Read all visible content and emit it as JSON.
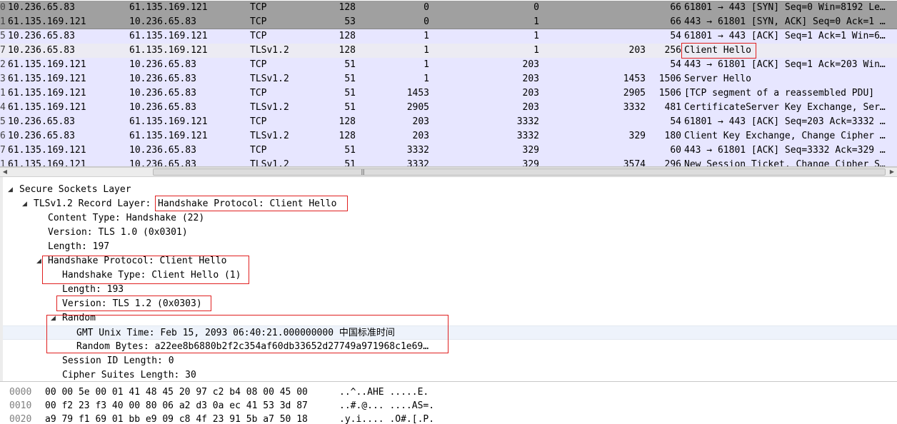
{
  "packets": [
    {
      "no": "0",
      "src": "10.236.65.83",
      "dst": "61.135.169.121",
      "proto": "TCP",
      "ttl": "128",
      "seq": "0",
      "ack": "0",
      "tcplen": "",
      "len": "66",
      "info": "61801 → 443 [SYN] Seq=0 Win=8192 Le…",
      "bg": "#a0a0a0"
    },
    {
      "no": "1",
      "src": "61.135.169.121",
      "dst": "10.236.65.83",
      "proto": "TCP",
      "ttl": "53",
      "seq": "0",
      "ack": "1",
      "tcplen": "",
      "len": "66",
      "info": "443 → 61801 [SYN, ACK] Seq=0 Ack=1 …",
      "bg": "#a0a0a0"
    },
    {
      "no": "5",
      "src": "10.236.65.83",
      "dst": "61.135.169.121",
      "proto": "TCP",
      "ttl": "128",
      "seq": "1",
      "ack": "1",
      "tcplen": "",
      "len": "54",
      "info": "61801 → 443 [ACK] Seq=1 Ack=1 Win=6…",
      "bg": "#e7e6ff"
    },
    {
      "no": "7",
      "src": "10.236.65.83",
      "dst": "61.135.169.121",
      "proto": "TLSv1.2",
      "ttl": "128",
      "seq": "1",
      "ack": "1",
      "tcplen": "203",
      "len": "256",
      "info": "Client Hello",
      "bg": "#ecebf3"
    },
    {
      "no": "2",
      "src": "61.135.169.121",
      "dst": "10.236.65.83",
      "proto": "TCP",
      "ttl": "51",
      "seq": "1",
      "ack": "203",
      "tcplen": "",
      "len": "54",
      "info": "443 → 61801 [ACK] Seq=1 Ack=203 Win…",
      "bg": "#e7e6ff"
    },
    {
      "no": "3",
      "src": "61.135.169.121",
      "dst": "10.236.65.83",
      "proto": "TLSv1.2",
      "ttl": "51",
      "seq": "1",
      "ack": "203",
      "tcplen": "1453",
      "len": "1506",
      "info": "Server Hello",
      "bg": "#e7e6ff"
    },
    {
      "no": "1",
      "src": "61.135.169.121",
      "dst": "10.236.65.83",
      "proto": "TCP",
      "ttl": "51",
      "seq": "1453",
      "ack": "203",
      "tcplen": "2905",
      "len": "1506",
      "info": "[TCP segment of a reassembled PDU]",
      "bg": "#e7e6ff"
    },
    {
      "no": "4",
      "src": "61.135.169.121",
      "dst": "10.236.65.83",
      "proto": "TLSv1.2",
      "ttl": "51",
      "seq": "2905",
      "ack": "203",
      "tcplen": "3332",
      "len": "481",
      "info": "CertificateServer Key Exchange, Ser…",
      "bg": "#e7e6ff"
    },
    {
      "no": "5",
      "src": "10.236.65.83",
      "dst": "61.135.169.121",
      "proto": "TCP",
      "ttl": "128",
      "seq": "203",
      "ack": "3332",
      "tcplen": "",
      "len": "54",
      "info": "61801 → 443 [ACK] Seq=203 Ack=3332 …",
      "bg": "#e7e6ff"
    },
    {
      "no": "6",
      "src": "10.236.65.83",
      "dst": "61.135.169.121",
      "proto": "TLSv1.2",
      "ttl": "128",
      "seq": "203",
      "ack": "3332",
      "tcplen": "329",
      "len": "180",
      "info": "Client Key Exchange, Change Cipher …",
      "bg": "#e7e6ff"
    },
    {
      "no": "7",
      "src": "61.135.169.121",
      "dst": "10.236.65.83",
      "proto": "TCP",
      "ttl": "51",
      "seq": "3332",
      "ack": "329",
      "tcplen": "",
      "len": "60",
      "info": "443 → 61801 [ACK] Seq=3332 Ack=329 …",
      "bg": "#e7e6ff"
    },
    {
      "no": "1",
      "src": "61.135.169.121",
      "dst": "10.236.65.83",
      "proto": "TLSv1.2",
      "ttl": "51",
      "seq": "3332",
      "ack": "329",
      "tcplen": "3574",
      "len": "296",
      "info": "New Session Ticket, Change Cipher S…",
      "bg": "#e7e6ff"
    }
  ],
  "details": [
    {
      "text": "Secure Sockets Layer",
      "expanded": true
    },
    {
      "text": "TLSv1.2 Record Layer: ",
      "suffix": "Handshake Protocol: Client Hello",
      "expanded": true
    },
    {
      "text": "Content Type: Handshake (22)"
    },
    {
      "text": "Version: TLS 1.0 (0x0301)"
    },
    {
      "text": "Length: 197"
    },
    {
      "text": "Handshake Protocol: Client Hello",
      "expanded": true
    },
    {
      "text": "Handshake Type: Client Hello (1)"
    },
    {
      "text": "Length: 193"
    },
    {
      "text": "Version: TLS 1.2 (0x0303)"
    },
    {
      "text": "Random",
      "expanded": true
    },
    {
      "text": "GMT Unix Time: Feb 15, 2093 06:40:21.000000000 中国标准时间",
      "selected": true
    },
    {
      "text": "Random Bytes: a22ee8b6880b2f2c354af60db33652d27749a971968c1e69…"
    },
    {
      "text": "Session ID Length: 0"
    },
    {
      "text": "Cipher Suites Length: 30"
    }
  ],
  "hex": [
    {
      "offset": "0000",
      "bytes": "00 00 5e 00 01 41 48 45  20 97 c2 b4 08 00 45 00",
      "ascii": "..^..AHE  .....E."
    },
    {
      "offset": "0010",
      "bytes": "00 f2 23 f3 40 00 80 06  a2 d3 0a ec 41 53 3d 87",
      "ascii": "..#.@... ....AS=."
    },
    {
      "offset": "0020",
      "bytes": "a9 79 f1 69 01 bb e9 09  c8 4f 23 91 5b a7 50 18",
      "ascii": ".y.i.... .O#.[.P."
    }
  ],
  "scroll": {
    "left_arrow": "◀",
    "right_arrow": "▶",
    "grip": "|||"
  },
  "colors": {
    "highlight_box": "#e02020",
    "tcp_row": "#e7e6ff",
    "syn_row": "#a0a0a0",
    "selected_row": "#ecebf3"
  }
}
